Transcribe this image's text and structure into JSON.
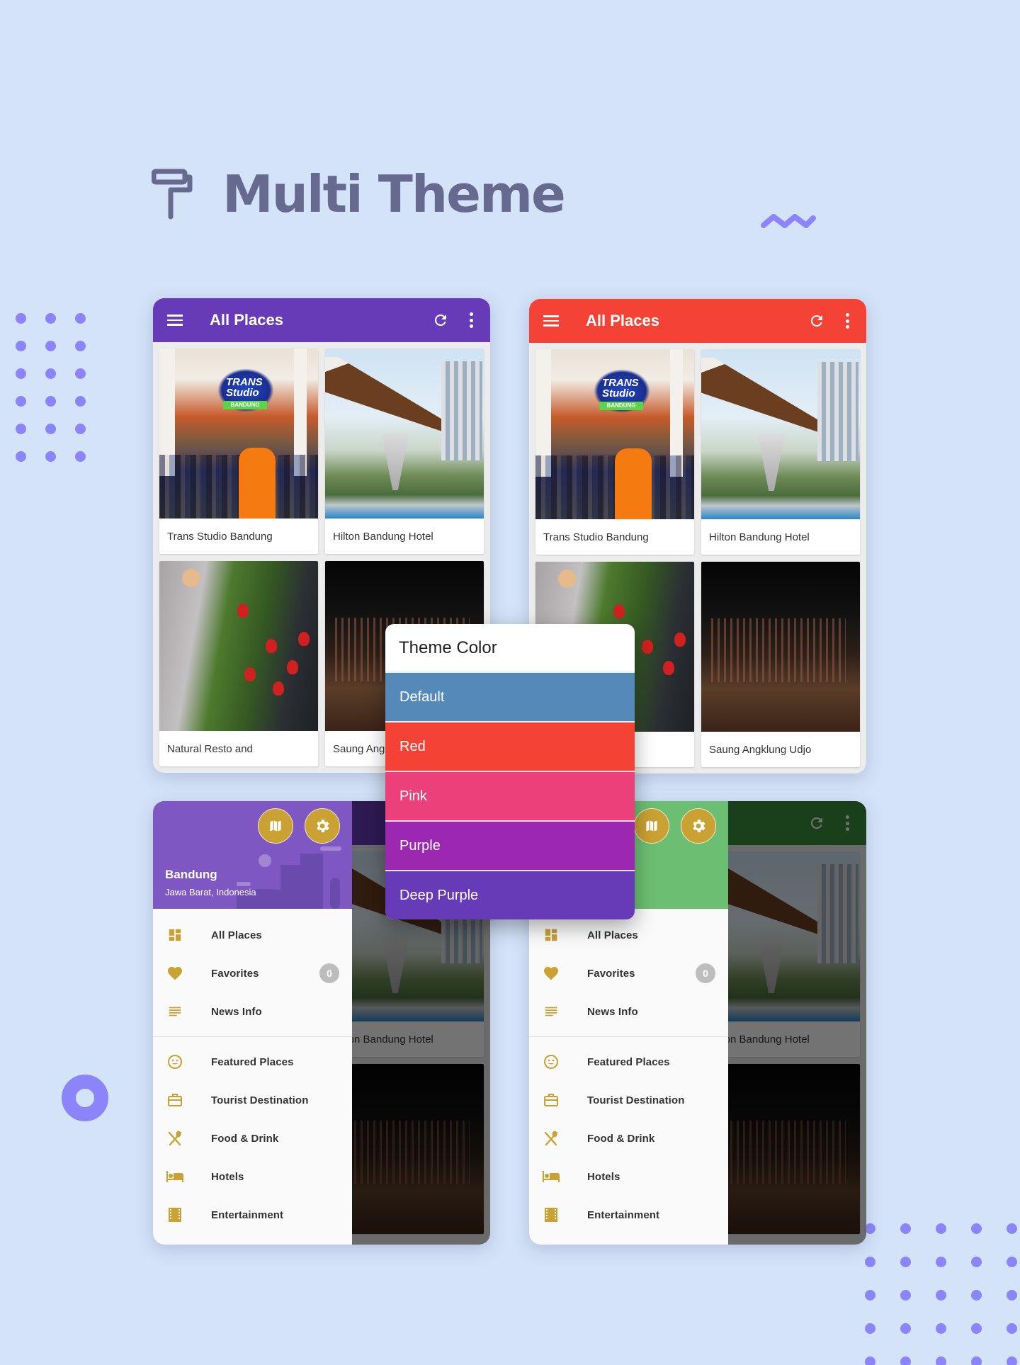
{
  "hero": {
    "title": "Multi Theme",
    "icon": "paint-roller-icon"
  },
  "decor": {
    "accent": "#8c84fa",
    "squiggle_icon": "squiggle-icon",
    "ring_icon": "ring-icon"
  },
  "app": {
    "title": "All Places",
    "icons": {
      "menu": "menu-icon",
      "refresh": "refresh-icon",
      "more": "more-vert-icon"
    },
    "places": [
      {
        "name": "Trans Studio Bandung",
        "photo": "trans-studio-photo"
      },
      {
        "name": "Hilton Bandung Hotel",
        "photo": "hilton-hotel-photo"
      },
      {
        "name": "Natural Resto and",
        "photo": "strawberry-photo"
      },
      {
        "name": "Saung Angklung Udjo",
        "photo": "saung-angklung-photo"
      }
    ],
    "partial_captions": {
      "saung_truncated": "Saung Ang",
      "hilton_truncated": "on Bandung Hotel"
    }
  },
  "themes_shown": {
    "top_left": {
      "name": "Deep Purple",
      "color": "#673ab7"
    },
    "top_right": {
      "name": "Red",
      "color": "#f44336"
    },
    "bottom_left": {
      "name": "Deep Purple",
      "header": "#7e57c2",
      "appbar_dim": "#2b1a4f"
    },
    "bottom_right": {
      "name": "Green",
      "header": "#6cbf72",
      "appbar_dim": "#22522a"
    }
  },
  "drawer": {
    "place": "Bandung",
    "region": "Jawa Barat, Indonesia",
    "icon_color": "#c9a233",
    "header_buttons": [
      {
        "icon": "map-icon"
      },
      {
        "icon": "settings-icon"
      }
    ],
    "items_primary": [
      {
        "label": "All Places",
        "icon": "dashboard-icon"
      },
      {
        "label": "Favorites",
        "icon": "heart-icon",
        "badge": "0"
      },
      {
        "label": "News Info",
        "icon": "notes-icon"
      }
    ],
    "items_categories": [
      {
        "label": "Featured Places",
        "icon": "smiley-icon"
      },
      {
        "label": "Tourist Destination",
        "icon": "briefcase-icon"
      },
      {
        "label": "Food & Drink",
        "icon": "restaurant-icon"
      },
      {
        "label": "Hotels",
        "icon": "bed-icon"
      },
      {
        "label": "Entertainment",
        "icon": "film-icon"
      }
    ]
  },
  "theme_dialog": {
    "title": "Theme Color",
    "options": [
      {
        "label": "Default",
        "color": "#5589b9"
      },
      {
        "label": "Red",
        "color": "#f44336"
      },
      {
        "label": "Pink",
        "color": "#ec407a"
      },
      {
        "label": "Purple",
        "color": "#9c27b0"
      },
      {
        "label": "Deep Purple",
        "color": "#673ab7"
      }
    ]
  }
}
